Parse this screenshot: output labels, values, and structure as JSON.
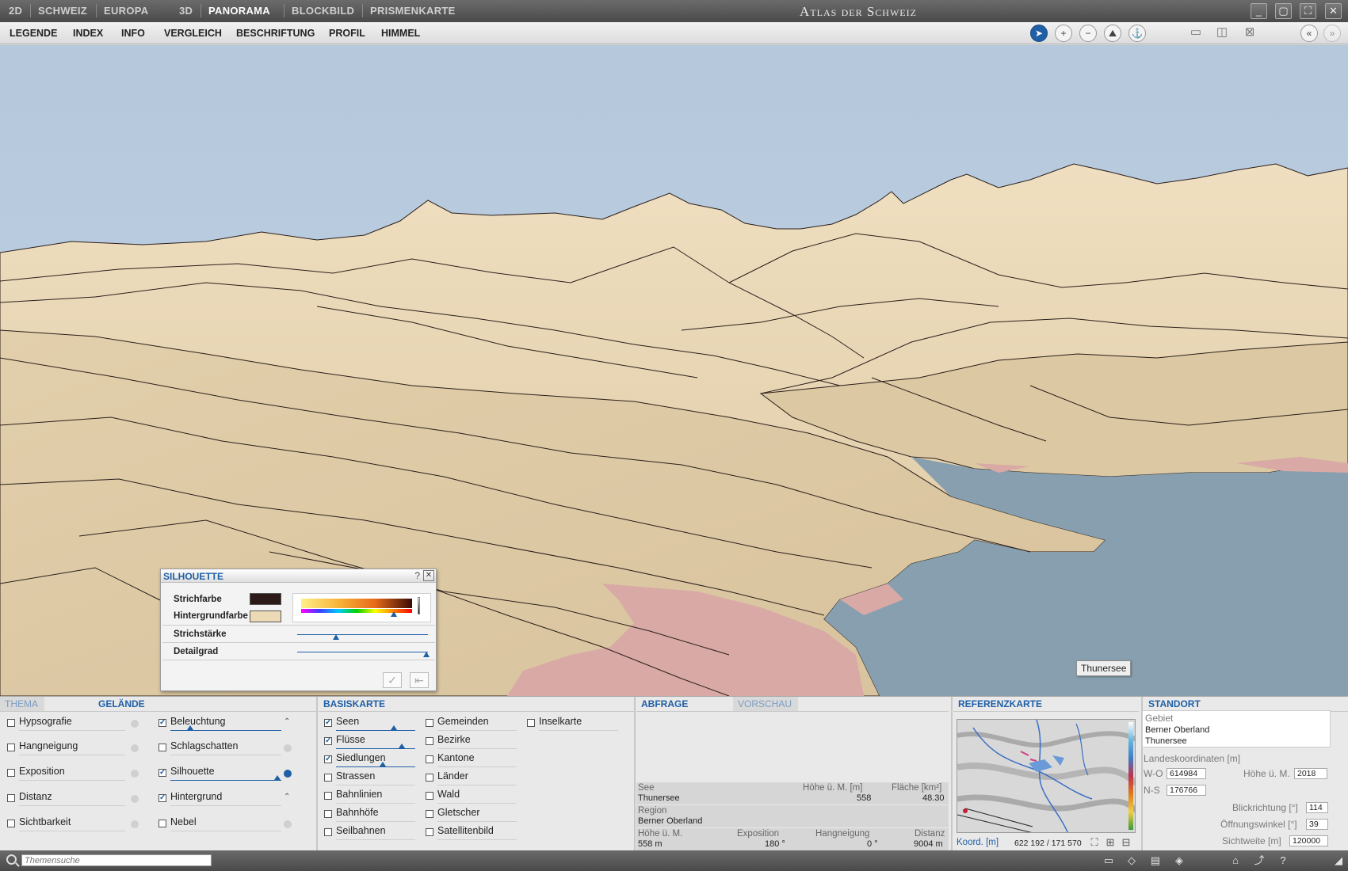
{
  "titlebar": {
    "modes_left": [
      "2D",
      "SCHWEIZ",
      "EUROPA"
    ],
    "modes_right": [
      "3D",
      "PANORAMA",
      "BLOCKBILD",
      "PRISMENKARTE"
    ],
    "title": "Atlas der Schweiz",
    "window_buttons": [
      "minimize-icon",
      "restore-icon",
      "fullscreen-icon",
      "close-icon"
    ]
  },
  "menu": {
    "items": [
      "LEGENDE",
      "INDEX",
      "INFO",
      "VERGLEICH",
      "BESCHRIFTUNG",
      "PROFIL",
      "HIMMEL"
    ],
    "tools": [
      "pointer-icon",
      "zoom-in-icon",
      "zoom-out-icon",
      "terrain-icon",
      "navigate-icon"
    ],
    "layout_tools": [
      "split-horizontal-icon",
      "split-vertical-icon",
      "close-view-icon"
    ],
    "collapse": [
      "collapse-left-icon",
      "collapse-right-icon"
    ]
  },
  "viewport": {
    "label": "Thunersee"
  },
  "dialog": {
    "title": "SILHOUETTE",
    "help": "?",
    "strichfarbe": "Strichfarbe",
    "hintergrundfarbe": "Hintergrundfarbe",
    "strichstaerke": "Strichstärke",
    "detailgrad": "Detailgrad",
    "colors": {
      "stroke": "#2b1a18",
      "background": "#ecd9b5"
    }
  },
  "thema": {
    "tabs": [
      "THEMA",
      "GELÄNDE"
    ],
    "col1": [
      "Hypsografie",
      "Hangneigung",
      "Exposition",
      "Distanz",
      "Sichtbarkeit"
    ],
    "col2": [
      "Beleuchtung",
      "Schlagschatten",
      "Silhouette",
      "Hintergrund",
      "Nebel"
    ],
    "col2_checked": [
      true,
      false,
      true,
      true,
      false
    ]
  },
  "basiskarte": {
    "tab": "BASISKARTE",
    "col1": [
      "Seen",
      "Flüsse",
      "Siedlungen",
      "Strassen",
      "Bahnlinien",
      "Bahnhöfe",
      "Seilbahnen"
    ],
    "col1_checked": [
      true,
      true,
      true,
      false,
      false,
      false,
      false
    ],
    "col2": [
      "Gemeinden",
      "Bezirke",
      "Kantone",
      "Länder",
      "Wald",
      "Gletscher",
      "Satellitenbild"
    ],
    "col3": [
      "Inselkarte"
    ]
  },
  "abfrage": {
    "tabs": [
      "ABFRAGE",
      "VORSCHAU"
    ],
    "see_label": "See",
    "see_value": "Thunersee",
    "hoehe_label": "Höhe ü. M. [m]",
    "hoehe_value": "558",
    "flaeche_label": "Fläche [km²]",
    "flaeche_value": "48.30",
    "region_label": "Region",
    "region_value": "Berner Oberland",
    "h2_label": "Höhe ü. M.",
    "h2_value": "558 m",
    "exp_label": "Exposition",
    "exp_value": "180 °",
    "hang_label": "Hangneigung",
    "hang_value": "0 °",
    "dist_label": "Distanz",
    "dist_value": "9004 m"
  },
  "referenz": {
    "tab": "REFERENZKARTE",
    "coord_label": "Koord. [m]",
    "coord_value": "622 192 / 171 570"
  },
  "standort": {
    "tab": "STANDORT",
    "gebiet_label": "Gebiet",
    "gebiet_1": "Berner Oberland",
    "gebiet_2": "Thunersee",
    "landeskoord": "Landeskoordinaten [m]",
    "wo_label": "W-O",
    "wo_value": "614984",
    "ns_label": "N-S",
    "ns_value": "176766",
    "hoehe_label": "Höhe ü. M.",
    "hoehe_value": "2018",
    "blick_label": "Blickrichtung [°]",
    "blick_value": "114",
    "oeff_label": "Öffnungswinkel [°]",
    "oeff_value": "39",
    "sicht_label": "Sichtweite [m]",
    "sicht_value": "120000"
  },
  "statusbar": {
    "search_placeholder": "Themensuche",
    "icons": [
      "folder-icon",
      "bookmark-icon",
      "print-icon",
      "layers-icon",
      "home-icon",
      "link-icon",
      "help-icon",
      "resize-icon"
    ]
  }
}
